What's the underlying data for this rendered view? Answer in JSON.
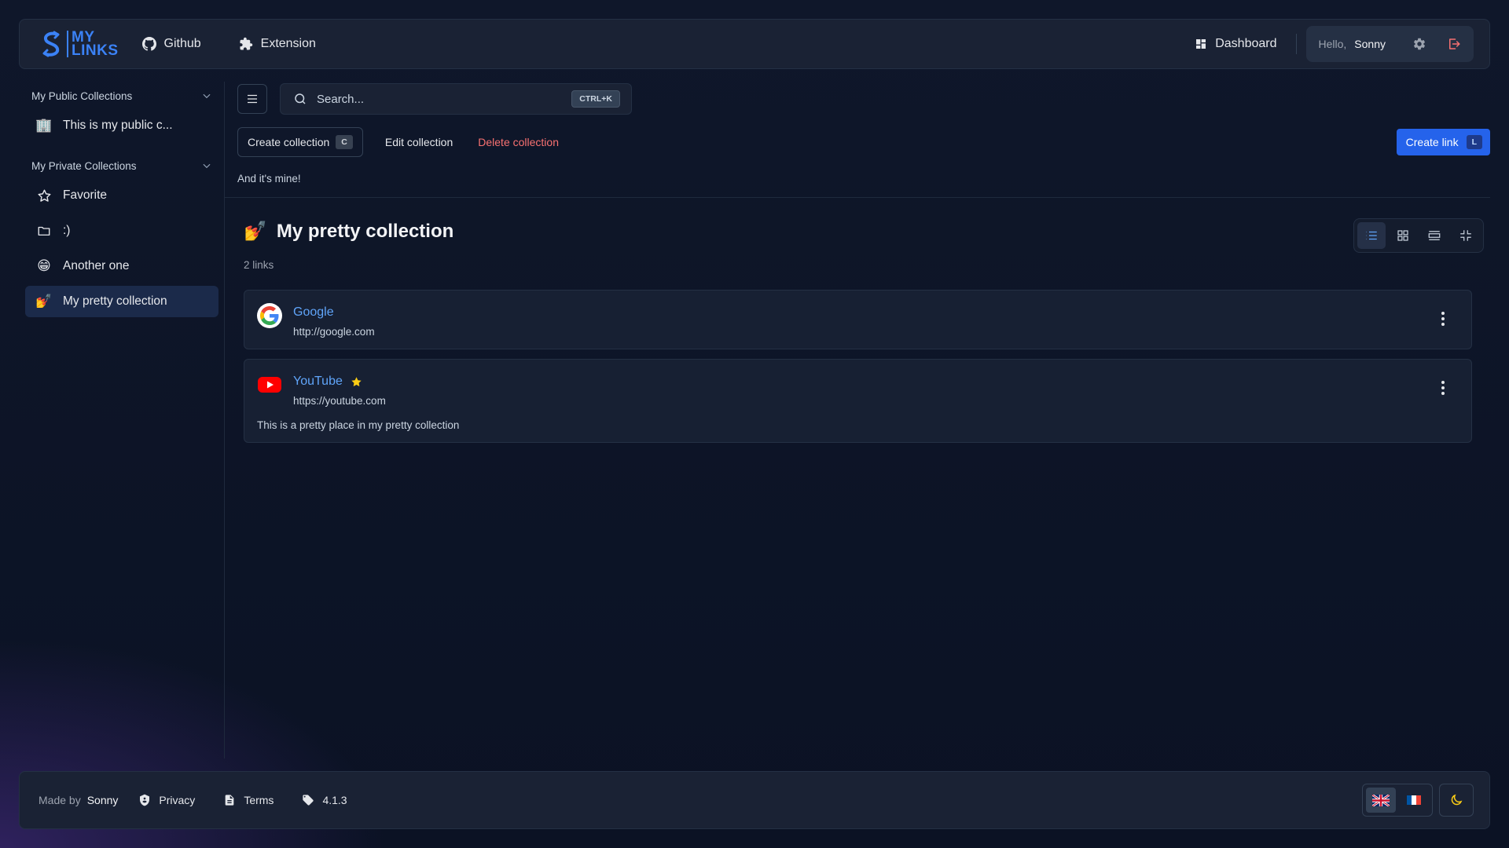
{
  "brand": {
    "line1": "MY",
    "line2": "LINKS",
    "accent": "#3b82f6"
  },
  "nav": {
    "github": "Github",
    "extension": "Extension",
    "dashboard": "Dashboard",
    "hello": "Hello,",
    "username": "Sonny"
  },
  "sidebar": {
    "public_title": "My Public Collections",
    "public_items": [
      {
        "label": "This is my public c...",
        "icon": "🏢"
      }
    ],
    "private_title": "My Private Collections",
    "private_items": [
      {
        "label": "Favorite",
        "icon": "star-icon"
      },
      {
        "label": ":)",
        "icon": "folder-icon"
      },
      {
        "label": "Another one",
        "icon": "😁"
      },
      {
        "label": "My pretty collection",
        "icon": "💅",
        "active": true
      }
    ]
  },
  "search": {
    "placeholder": "Search...",
    "shortcut": "CTRL+K"
  },
  "actions": {
    "create_collection": "Create collection",
    "create_collection_key": "C",
    "edit_collection": "Edit collection",
    "delete_collection": "Delete collection",
    "create_link": "Create link",
    "create_link_key": "L"
  },
  "collection": {
    "description": "And it's mine!",
    "emoji": "💅",
    "title": "My pretty collection",
    "count": "2 links",
    "view_modes": [
      "list",
      "grid",
      "rows",
      "compact"
    ],
    "active_view": "list"
  },
  "links": [
    {
      "title": "Google",
      "url": "http://google.com",
      "favorite": false,
      "description": "",
      "icon": "google-icon"
    },
    {
      "title": "YouTube",
      "url": "https://youtube.com",
      "favorite": true,
      "description": "This is a pretty place in my pretty collection",
      "icon": "youtube-icon"
    }
  ],
  "footer": {
    "made_by": "Made by",
    "author": "Sonny",
    "privacy": "Privacy",
    "terms": "Terms",
    "version": "4.1.3",
    "languages": [
      "en",
      "fr"
    ],
    "active_language": "en"
  },
  "colors": {
    "link": "#60a5fa",
    "danger": "#f87171",
    "primary": "#2563eb",
    "star": "#facc15"
  }
}
